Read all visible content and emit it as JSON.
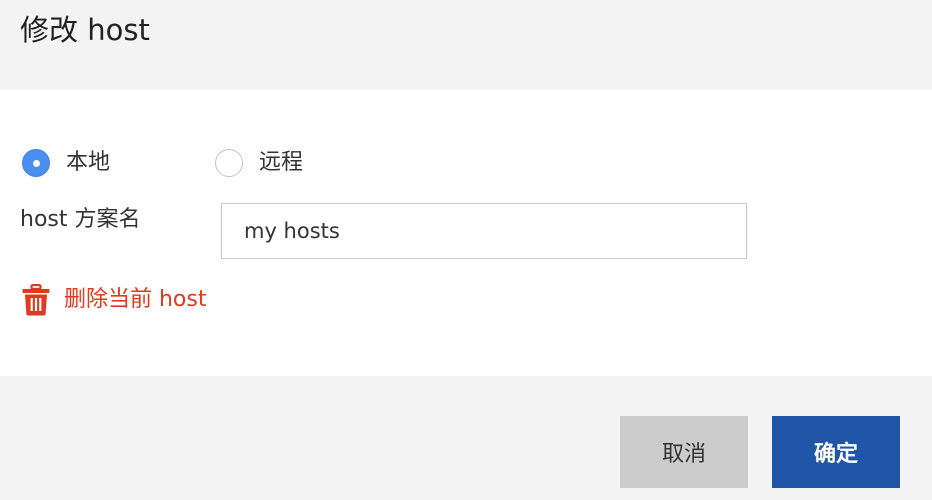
{
  "dialog": {
    "title": "修改 host"
  },
  "mode": {
    "selected": "本地",
    "options": [
      {
        "label": "本地",
        "checked": true
      },
      {
        "label": "远程",
        "checked": false
      }
    ]
  },
  "form": {
    "name_label": "host 方案名",
    "name_value": "my hosts"
  },
  "delete": {
    "label": "删除当前 host",
    "icon": "trash-icon"
  },
  "buttons": {
    "cancel_label": "取消",
    "ok_label": "确定"
  },
  "colors": {
    "accent": "#4a8ff0",
    "primary_button": "#1f56a8",
    "danger": "#e0391f",
    "secondary_button": "#cccccc"
  }
}
